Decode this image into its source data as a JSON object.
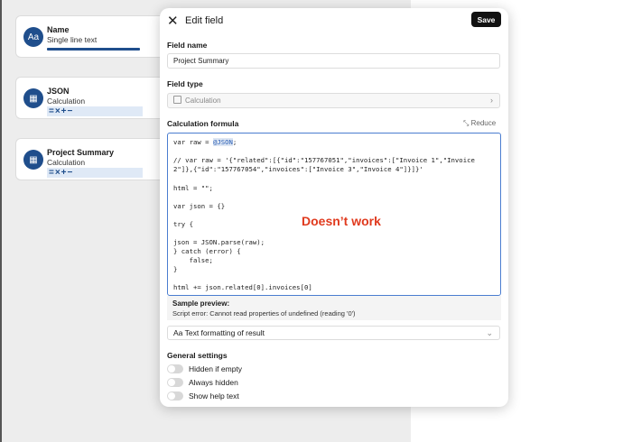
{
  "fields": [
    {
      "icon": "Aa",
      "name": "Name",
      "type": "Single line text",
      "badge": ""
    },
    {
      "icon": "▦",
      "name": "JSON",
      "type": "Calculation",
      "badge": "=×+−"
    },
    {
      "icon": "▦",
      "name": "Project Summary",
      "type": "Calculation",
      "badge": "=×+−"
    }
  ],
  "panel": {
    "title": "Edit field",
    "save_label": "Save",
    "field_name_label": "Field name",
    "field_name_value": "Project Summary",
    "field_type_label": "Field type",
    "field_type_value": "Calculation",
    "formula_label": "Calculation formula",
    "reduce_label": "Reduce",
    "code": {
      "l1_pre": "var raw = ",
      "l1_tok": "@JSON",
      "l1_post": ";",
      "l2": "// var raw = '{\"related\":[{\"id\":\"157767051\",\"invoices\":[\"Invoice 1\",\"Invoice",
      "l3": "2\"]},{\"id\":\"157767054\",\"invoices\":[\"Invoice 3\",\"Invoice 4\"]}]}'",
      "l4": "html = \"\";",
      "l5": "var json = {}",
      "l6": "try {",
      "l7": "json = JSON.parse(raw);",
      "l8": "} catch (error) {",
      "l9": "    false;",
      "l10": "}",
      "l11": "html += json.related[0].invoices[0]"
    },
    "annotation": "Doesn’t work",
    "preview_title": "Sample preview:",
    "preview_error": "Script error: Cannot read properties of undefined (reading '0')",
    "text_formatting_label": "Aa Text formatting of result",
    "general_settings_label": "General settings",
    "toggles": [
      "Hidden if empty",
      "Always hidden",
      "Show help text"
    ]
  }
}
